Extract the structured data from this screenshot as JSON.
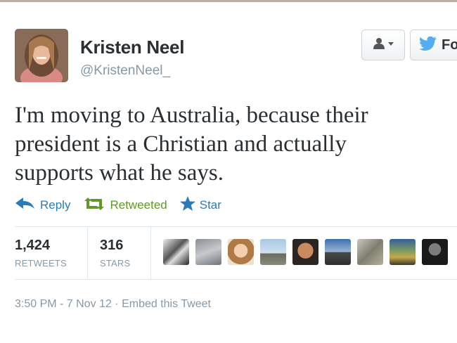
{
  "user": {
    "name": "Kristen Neel",
    "handle": "@KristenNeel_",
    "avatar_icon": "profile-photo"
  },
  "buttons": {
    "user_actions_icon": "person-dropdown-icon",
    "follow_label": "Fo"
  },
  "tweet": {
    "line1": "I'm moving to Australia, because their",
    "line2": "president is a Christian and actually",
    "line3": "supports what he says."
  },
  "actions": {
    "reply": "Reply",
    "retweeted": "Retweeted",
    "star": "Star"
  },
  "stats": {
    "retweets_count": "1,424",
    "retweets_label": "RETWEETS",
    "stars_count": "316",
    "stars_label": "STARS"
  },
  "engager_avatar_count": 9,
  "footer": {
    "timestamp": "3:50 PM - 7 Nov 12",
    "separator": " · ",
    "embed": "Embed this Tweet"
  },
  "colors": {
    "link_blue": "#2b7bb9",
    "retweet_green": "#609928",
    "muted": "#8899a6",
    "twitter_bird": "#55acee"
  }
}
